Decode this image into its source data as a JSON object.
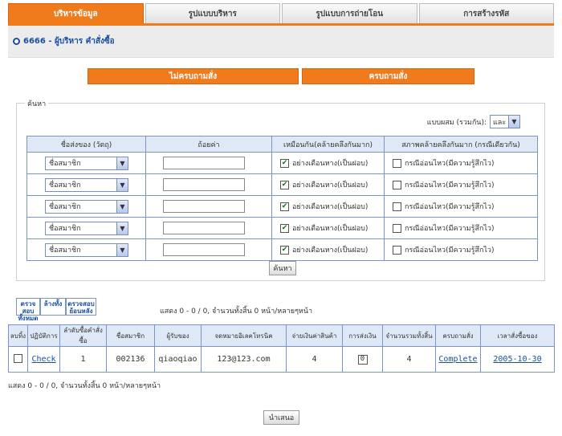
{
  "tabs": [
    "บริหารข้อมูล",
    "รูปแบบบริหาร",
    "รูปแบบการถ่ายโอน",
    "การสร้างรหัส"
  ],
  "header": {
    "title": "6666 - ผู้บริหาร คำสั่งซื้อ"
  },
  "toggles": {
    "left": "ไม่ครบถามสั่ง",
    "right": "ครบถามสั่ง"
  },
  "search": {
    "legend": "ค้นหา",
    "logic_label": "แบบผสม (รวมกัน):",
    "logic_value": "และ",
    "headers": [
      "ชื่อส่งของ (วัตถุ)",
      "ถ้อยค่า",
      "เหมือนกัน(คล้ายคลึงกันมาก)",
      "สภาพคล้ายคลึงกันมาก (กรณีเดียวกัน)"
    ],
    "rows": [
      {
        "field": "ชื่อสมาชิก",
        "value": "",
        "like_checked": true,
        "like_label": "อย่างเดือนหาง(เป็นฝอบ)",
        "exact_checked": false,
        "exact_label": "กรณีอ่อนไหว(มีความรู้สึกไว)"
      },
      {
        "field": "ชื่อสมาชิก",
        "value": "",
        "like_checked": true,
        "like_label": "อย่างเดือนหาง(เป็นฝอบ)",
        "exact_checked": false,
        "exact_label": "กรณีอ่อนไหว(มีความรู้สึกไว)"
      },
      {
        "field": "ชื่อสมาชิก",
        "value": "",
        "like_checked": true,
        "like_label": "อย่างเดือนหาง(เป็นฝอบ)",
        "exact_checked": false,
        "exact_label": "กรณีอ่อนไหว(มีความรู้สึกไว)"
      },
      {
        "field": "ชื่อสมาชิก",
        "value": "",
        "like_checked": true,
        "like_label": "อย่างเดือนหาง(เป็นฝอบ)",
        "exact_checked": false,
        "exact_label": "กรณีอ่อนไหว(มีความรู้สึกไว)"
      },
      {
        "field": "ชื่อสมาชิก",
        "value": "",
        "like_checked": true,
        "like_label": "อย่างเดือนหาง(เป็นฝอบ)",
        "exact_checked": false,
        "exact_label": "กรณีอ่อนไหว(มีความรู้สึกไว)"
      }
    ],
    "button": "ค้นหา"
  },
  "actions": {
    "check_all": "ตรวจสอบ ทั้งหมด",
    "clear_all": "ล้างทั้ง",
    "check_back": "ตรวจสอบ ย้อนหลัง"
  },
  "paging_top": "แสดง 0 - 0 / 0, จำนวนทั้งสิ้น 0 หน้า/หลายๆหน้า",
  "paging_bottom": "แสดง 0 - 0 / 0, จำนวนทั้งสิ้น 0 หน้า/หลายๆหน้า",
  "results": {
    "headers": [
      "ลบทิ้ง",
      "ปฏิบัติการ",
      "ลำดับซื้อคำสั่งซื้อ",
      "ชื่อสมาชิก",
      "ผู้รับของ",
      "จดหมายอิเลคโทรนิค",
      "จ่ายเงินค่าสินค้า",
      "การส่งเงิน",
      "จำนวนรวมทั้งสิ้น",
      "ครบถามสั่ง",
      "เวลาสั่งซื้อของ"
    ],
    "rows": [
      {
        "action": "Check",
        "order_no": "1",
        "member": "002136",
        "receiver": "qiaoqiao",
        "email": "123@123.com",
        "payment": "4",
        "transfer": "0",
        "total": "4",
        "status": "Complete",
        "date": "2005-10-30"
      }
    ]
  },
  "submit": "นำเสนอ"
}
